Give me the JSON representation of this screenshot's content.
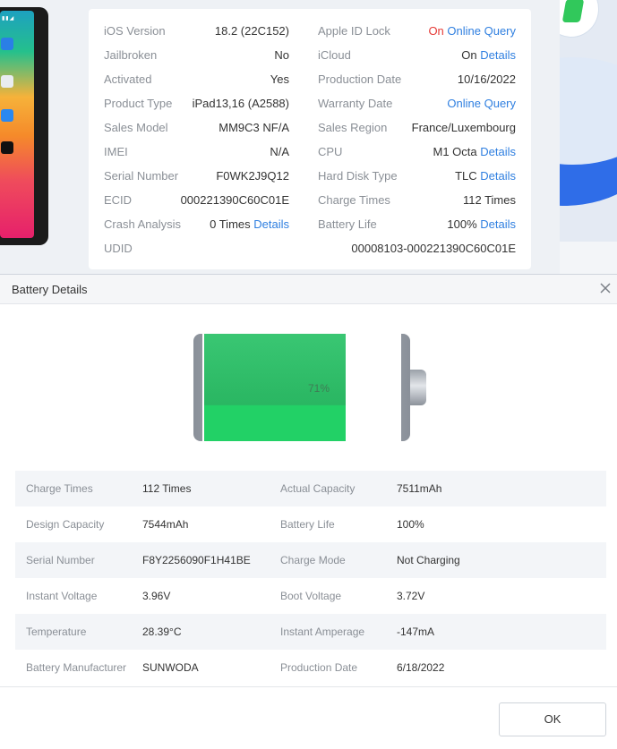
{
  "device_info": {
    "left_column": [
      {
        "label": "iOS Version",
        "value": "18.2 (22C152)"
      },
      {
        "label": "Jailbroken",
        "value": "No"
      },
      {
        "label": "Activated",
        "value": "Yes"
      },
      {
        "label": "Product Type",
        "value": "iPad13,16 (A2588)"
      },
      {
        "label": "Sales Model",
        "value": "MM9C3 NF/A"
      },
      {
        "label": "IMEI",
        "value": "N/A"
      },
      {
        "label": "Serial Number",
        "value": "F0WK2J9Q12"
      },
      {
        "label": "ECID",
        "value": "000221390C60C01E"
      },
      {
        "label": "Crash Analysis",
        "value": "0 Times",
        "link": "Details"
      }
    ],
    "right_column": [
      {
        "label": "Apple ID Lock",
        "value": "On",
        "link": "Online Query"
      },
      {
        "label": "iCloud",
        "value": "On",
        "link": "Details"
      },
      {
        "label": "Production Date",
        "value": "10/16/2022"
      },
      {
        "label": "Warranty Date",
        "value": "",
        "link": "Online Query"
      },
      {
        "label": "Sales Region",
        "value": "France/Luxembourg"
      },
      {
        "label": "CPU",
        "value": "M1 Octa",
        "link": "Details"
      },
      {
        "label": "Hard Disk Type",
        "value": "TLC",
        "link": "Details"
      },
      {
        "label": "Charge Times",
        "value": "112 Times"
      },
      {
        "label": "Battery Life",
        "value": "100%",
        "link": "Details"
      }
    ],
    "udid": {
      "label": "UDID",
      "value": "00008103-000221390C60C01E"
    }
  },
  "dialog": {
    "title": "Battery Details",
    "battery_level_percent": 71,
    "battery_label": "71%",
    "rows": [
      {
        "l1": "Charge Times",
        "v1": "112 Times",
        "l2": "Actual Capacity",
        "v2": "7511mAh"
      },
      {
        "l1": "Design Capacity",
        "v1": "7544mAh",
        "l2": "Battery Life",
        "v2": "100%"
      },
      {
        "l1": "Serial Number",
        "v1": "F8Y2256090F1H41BE",
        "l2": "Charge Mode",
        "v2": "Not Charging"
      },
      {
        "l1": "Instant Voltage",
        "v1": "3.96V",
        "l2": "Boot Voltage",
        "v2": "3.72V"
      },
      {
        "l1": "Temperature",
        "v1": "28.39°C",
        "l2": "Instant Amperage",
        "v2": "-147mA"
      },
      {
        "l1": "Battery Manufacturer",
        "v1": "SUNWODA",
        "l2": "Production Date",
        "v2": "6/18/2022"
      }
    ],
    "ok_label": "OK"
  },
  "colors": {
    "accent_link": "#2f7fe0",
    "battery_green": "#22d166",
    "status_red": "#e53935"
  }
}
